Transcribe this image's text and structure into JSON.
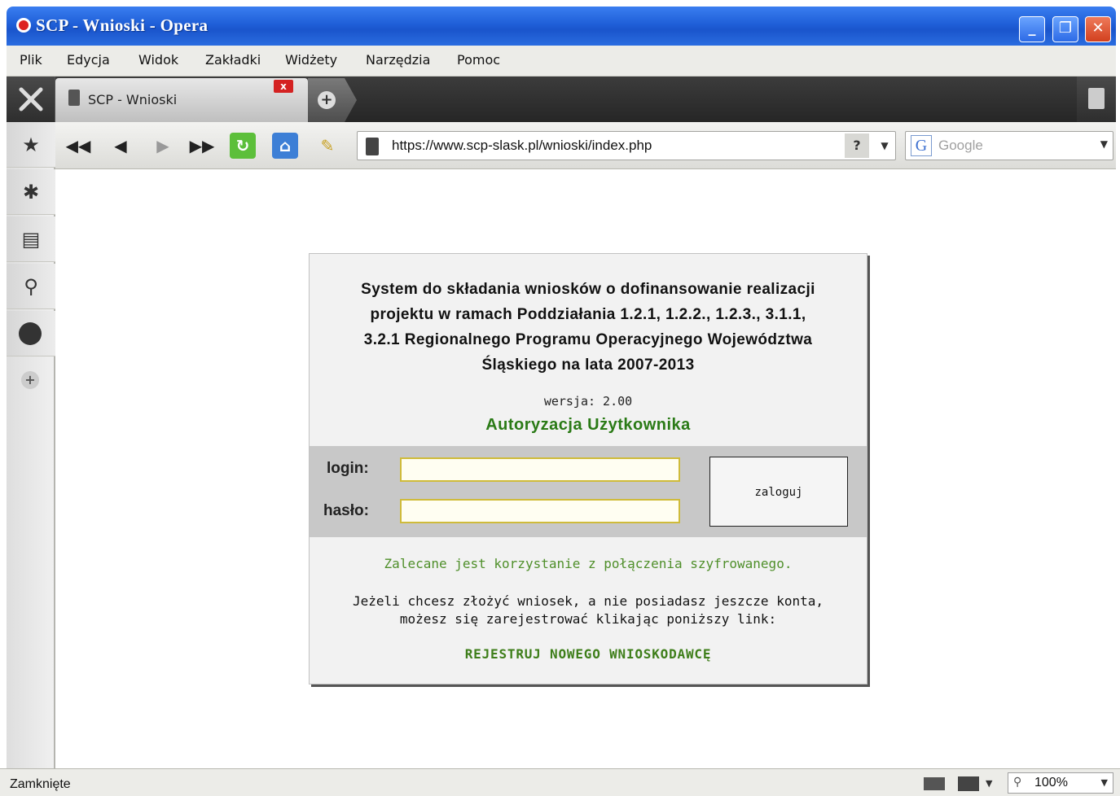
{
  "window": {
    "title": "SCP - Wnioski - Opera",
    "minimize_glyph": "_",
    "restore_glyph": "❐",
    "close_glyph": "✕"
  },
  "menu": [
    "Plik",
    "Edycja",
    "Widok",
    "Zakładki",
    "Widżety",
    "Narzędzia",
    "Pomoc"
  ],
  "tabs": [
    {
      "label": "SCP - Wnioski",
      "close_glyph": "x"
    }
  ],
  "newtab_glyph": "+",
  "address": {
    "url": "https://www.scp-slask.pl/wnioski/index.php",
    "help_glyph": "?",
    "dropdown_glyph": "▼"
  },
  "search": {
    "engine_glyph": "G",
    "placeholder": "Google",
    "dropdown_glyph": "▼"
  },
  "nav_glyphs": {
    "rewind": "◀◀",
    "back": "◀",
    "forward": "▶",
    "fast_forward": "▶▶",
    "reload": "↻",
    "home": "⌂",
    "edit": "✎"
  },
  "sidebar_glyphs": {
    "bookmarks": "★",
    "settings": "✱",
    "notes": "▤",
    "transfers": "⚲",
    "add": "+"
  },
  "page": {
    "title_lines": [
      "System do składania wniosków o dofinansowanie realizacji",
      "projektu w ramach Poddziałania 1.2.1, 1.2.2., 1.2.3., 3.1.1,",
      "3.2.1 Regionalnego Programu Operacyjnego Województwa",
      "Śląskiego na lata 2007-2013"
    ],
    "version": "wersja: 2.00",
    "auth_heading": "Autoryzacja Użytkownika",
    "login_label": "login:",
    "password_label": "hasło:",
    "login_value": "",
    "password_value": "",
    "submit_label": "zaloguj",
    "recommendation": "Zalecane jest korzystanie z połączenia szyfrowanego.",
    "info_line1": "Jeżeli chcesz złożyć wniosek, a nie posiadasz jeszcze konta,",
    "info_line2": "możesz się zarejestrować klikając poniższy link:",
    "register_link": "REJESTRUJ NOWEGO WNIOSKODAWCĘ"
  },
  "status": {
    "text": "Zamknięte",
    "zoom": "100%",
    "zoom_glyph": "⚲",
    "dropdown_glyph": "▼"
  },
  "colors": {
    "accent_green": "#2a7a16",
    "link_green": "#3e7e1a",
    "titlebar_blue": "#1f5fd8",
    "close_red": "#d42222"
  }
}
